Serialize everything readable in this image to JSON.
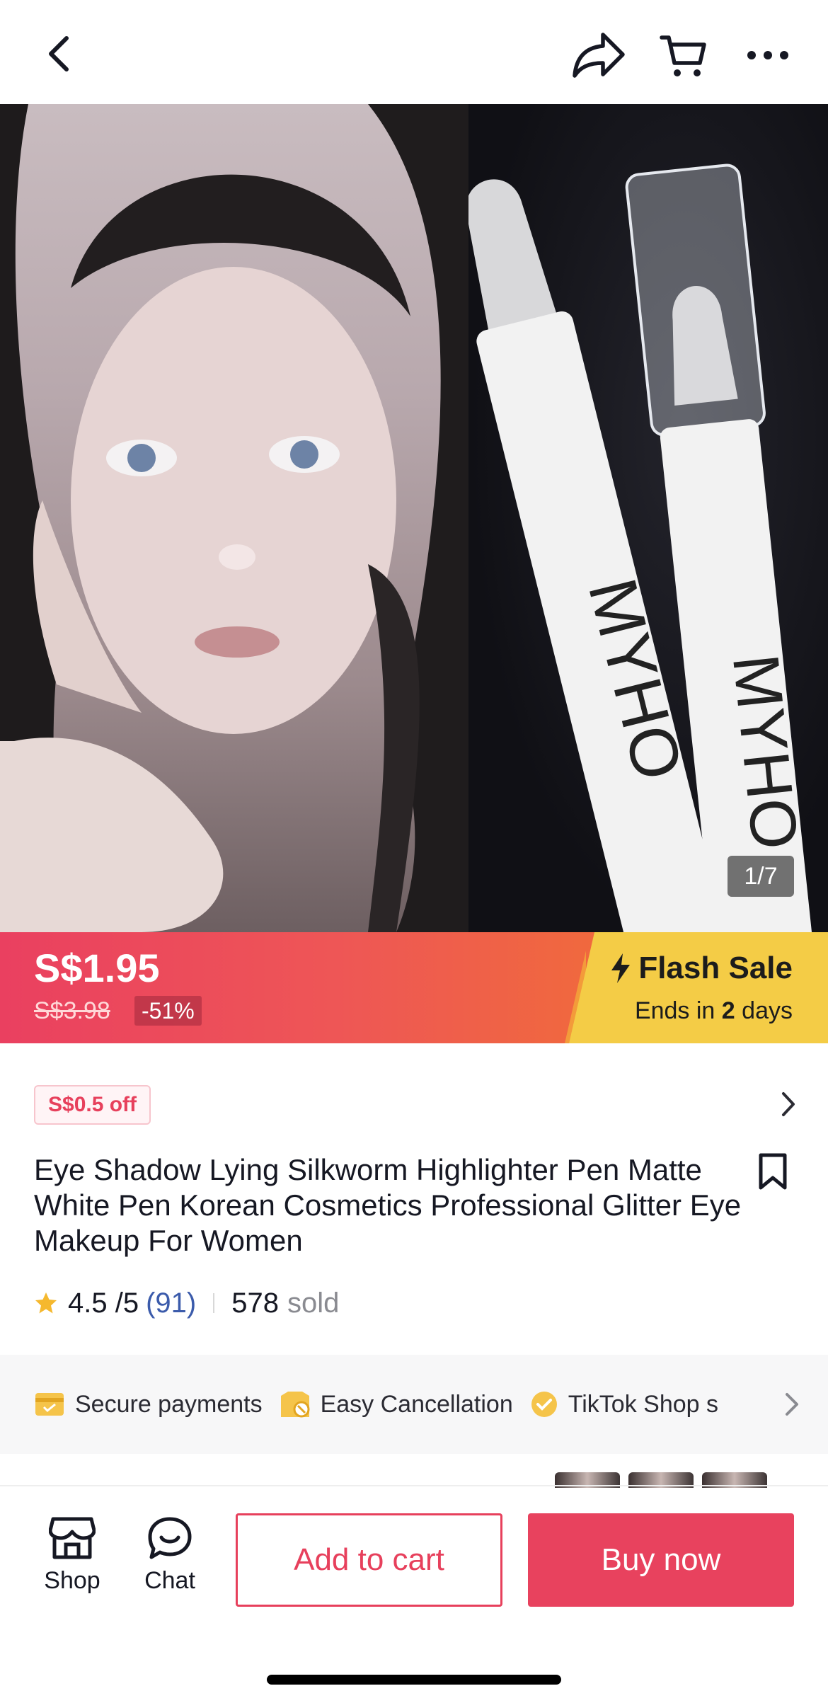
{
  "nav": {
    "back_icon": "chevron-left-icon",
    "share_icon": "share-arrow-icon",
    "cart_icon": "cart-icon",
    "more_icon": "more-dots-icon"
  },
  "gallery": {
    "counter": "1/7",
    "product_brand_text": "MYHO"
  },
  "sale": {
    "price": "S$1.95",
    "original_price": "S$3.98",
    "discount": "-51%",
    "flash_label": "Flash Sale",
    "ends_prefix": "Ends in",
    "ends_value": "2",
    "ends_suffix": "days",
    "colors": {
      "price_bg": "#ea4060",
      "flash_bg": "#f4cc46"
    }
  },
  "product": {
    "coupon": "S$0.5 off",
    "title": "Eye Shadow Lying Silkworm Highlighter Pen Matte White Pen Korean Cosmetics Professional Glitter Eye Makeup For Women",
    "rating": "4.5 /5",
    "review_count": "(91)",
    "sold_count": "578",
    "sold_label": "sold"
  },
  "benefits": [
    {
      "label": "Secure payments",
      "icon": "card-icon"
    },
    {
      "label": "Easy Cancellation",
      "icon": "box-cancel-icon"
    },
    {
      "label": "TikTok Shop s",
      "icon": "verified-badge-icon"
    }
  ],
  "bottom": {
    "shop_label": "Shop",
    "chat_label": "Chat",
    "add_to_cart": "Add to cart",
    "buy_now": "Buy now",
    "accent": "#e8425e"
  }
}
